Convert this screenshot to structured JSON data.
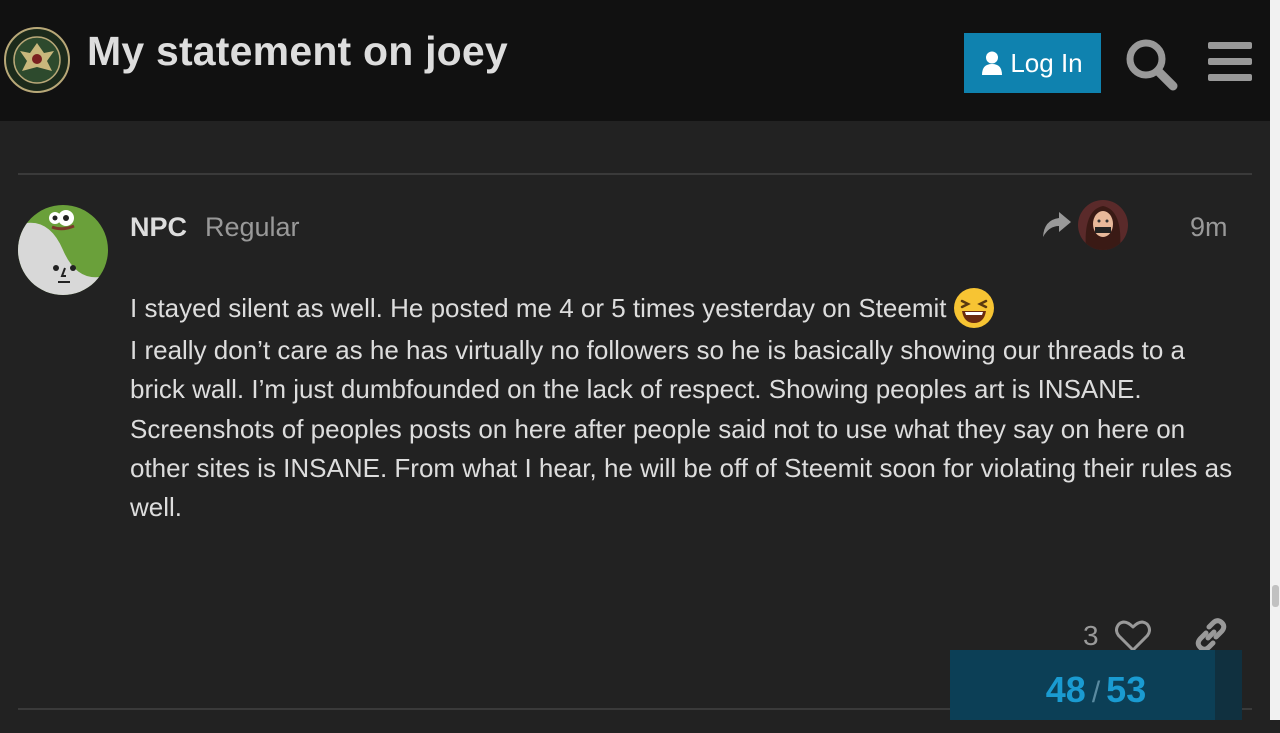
{
  "header": {
    "title": "My statement on joey",
    "login_label": "Log In",
    "logo_icon": "army-seal-logo",
    "search_icon": "search-icon",
    "menu_icon": "hamburger-icon"
  },
  "post": {
    "username": "NPC",
    "user_title": "Regular",
    "date": "9m",
    "body": [
      "I stayed silent as well. He posted me 4 or 5 times yesterday on Steemit",
      "I really don’t care as he has virtually no followers so he is basically showing our threads to a brick wall. I’m just dumbfounded on the lack of respect. Showing peoples art is INSANE. Screenshots of peoples posts on here after people said not to use what they say on here on other sites is INSANE. From what I hear, he will be off of Steemit soon for violating their rules as well."
    ],
    "emoji": "laughing-emoji",
    "like_count": "3"
  },
  "progress": {
    "current": "48",
    "separator": "/",
    "total": "53",
    "fraction": 0.906
  },
  "colors": {
    "background": "#222222",
    "header": "#111111",
    "accent": "#0f82af",
    "progress_text": "#1a9bd1"
  }
}
